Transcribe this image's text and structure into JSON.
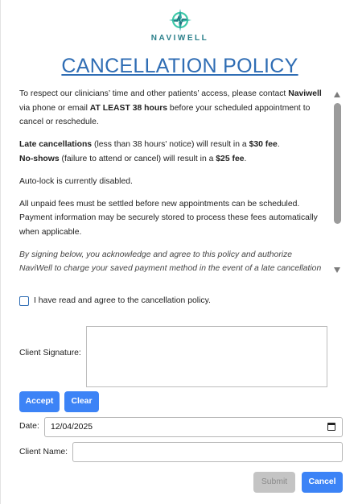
{
  "brand": {
    "name": "NAVIWELL"
  },
  "title": "CANCELLATION POLICY",
  "policy": {
    "p1_a": "To respect our clinicians’ time and other patients’ access, please contact ",
    "p1_b": "Naviwell",
    "p1_c": " via phone or email ",
    "p1_d": "AT LEAST 38 hours",
    "p1_e": " before your scheduled appointment to cancel or reschedule.",
    "p2_a": "Late cancellations",
    "p2_b": " (less than 38 hours' notice) will result in a ",
    "p2_c": "$30 fee",
    "p2_d": ".",
    "p2_e": "No-shows",
    "p2_f": " (failure to attend or cancel) will result in a ",
    "p2_g": "$25 fee",
    "p2_h": ".",
    "p3": "Auto-lock is currently disabled.",
    "p4": "All unpaid fees must be settled before new appointments can be scheduled. Payment information may be securely stored to process these fees automatically when applicable.",
    "p5": "By signing below, you acknowledge and agree to this policy and authorize NaviWell to charge your saved payment method in the event of a late cancellation or no-show."
  },
  "agree_label": "I have read and agree to the cancellation policy.",
  "signature": {
    "label": "Client Signature:"
  },
  "buttons": {
    "accept": "Accept",
    "clear": "Clear",
    "submit": "Submit",
    "cancel": "Cancel"
  },
  "date": {
    "label": "Date:",
    "value": "12/04/2025"
  },
  "client_name": {
    "label": "Client Name:",
    "value": ""
  },
  "colors": {
    "accent": "#3c83f6",
    "title": "#2f6db4",
    "brand": "#2a7f8a",
    "disabled": "#c4c4c4"
  }
}
